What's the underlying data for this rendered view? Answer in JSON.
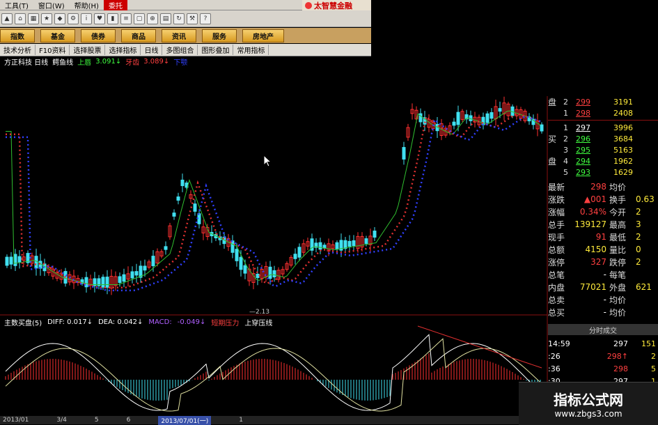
{
  "menu": {
    "items": [
      "工具(T)",
      "窗口(W)",
      "帮助(H)",
      "委托"
    ],
    "brand": "太智慧金融"
  },
  "tabs": [
    "指数",
    "基金",
    "债券",
    "商品",
    "资讯",
    "服务",
    "房地产"
  ],
  "subtools": [
    "技术分析",
    "F10资料",
    "选择股票",
    "选择指标",
    "日线",
    "多图组合",
    "图形叠加",
    "常用指标"
  ],
  "info": {
    "stock": "方正科技 日线",
    "indicator": "鳄鱼线",
    "up_label": "上唇",
    "up_val": "3.091↓",
    "mid_label": "牙齿",
    "mid_val": "3.089↓",
    "low_label": "下颚"
  },
  "low_label": "2.13",
  "sub": {
    "name": "主数买盘(5)",
    "diff": "DIFF: 0.017↓",
    "dea": "DEA: 0.042↓",
    "macd_label": "MACD:",
    "macd_val": "-0.049↓",
    "short": "短期压力",
    "up": "上穿压线"
  },
  "dates": [
    "2013/01",
    "3/4",
    "5",
    "6",
    "2013/07/01(一)",
    "1"
  ],
  "orderbook": {
    "sell": [
      {
        "side": "盘",
        "lvl": "2",
        "price": "299",
        "vol": "3191"
      },
      {
        "side": "",
        "lvl": "1",
        "price": "298",
        "vol": "2408"
      }
    ],
    "buy": [
      {
        "side": "",
        "lvl": "1",
        "price": "297",
        "vol": "3996"
      },
      {
        "side": "买",
        "lvl": "2",
        "price": "296",
        "vol": "3684"
      },
      {
        "side": "",
        "lvl": "3",
        "price": "295",
        "vol": "5163"
      },
      {
        "side": "盘",
        "lvl": "4",
        "price": "294",
        "vol": "1962"
      },
      {
        "side": "",
        "lvl": "5",
        "price": "293",
        "vol": "1629"
      }
    ]
  },
  "stats": [
    {
      "l": "最新",
      "v": "298",
      "l2": "均价",
      "v2": ""
    },
    {
      "l": "涨跌",
      "v": "▲001",
      "l2": "换手",
      "v2": "0.63"
    },
    {
      "l": "涨幅",
      "v": "0.34%",
      "l2": "今开",
      "v2": "2"
    },
    {
      "l": "总手",
      "v": "139127",
      "l2": "最高",
      "v2": "3"
    },
    {
      "l": "现手",
      "v": "91",
      "l2": "最低",
      "v2": "2"
    },
    {
      "l": "总额",
      "v": "4150",
      "l2": "量比",
      "v2": "0"
    },
    {
      "l": "涨停",
      "v": "327",
      "l2": "跌停",
      "v2": "2"
    },
    {
      "l": "总笔",
      "v": "-",
      "l2": "每笔",
      "v2": ""
    },
    {
      "l": "内盘",
      "v": "77021",
      "l2": "外盘",
      "v2": "621"
    },
    {
      "l": "总卖",
      "v": "-",
      "l2": "均价",
      "v2": ""
    },
    {
      "l": "总买",
      "v": "-",
      "l2": "均价",
      "v2": ""
    }
  ],
  "ticks_title": "分时成交",
  "ticks": [
    {
      "t": "14:59",
      "p": "297",
      "v": "151"
    },
    {
      "t": ":26",
      "p": "298↑",
      "v": "2"
    },
    {
      "t": ":36",
      "p": "298",
      "v": "5"
    },
    {
      "t": ":30",
      "p": "297",
      "v": "1"
    }
  ],
  "watermark": {
    "l1": "指标公式网",
    "l2": "www.zbgs3.com"
  },
  "colors": {
    "up": "#ff3030",
    "down": "#40e0f0",
    "mid": "#e03030",
    "blue": "#3040ff",
    "green": "#30c030"
  }
}
